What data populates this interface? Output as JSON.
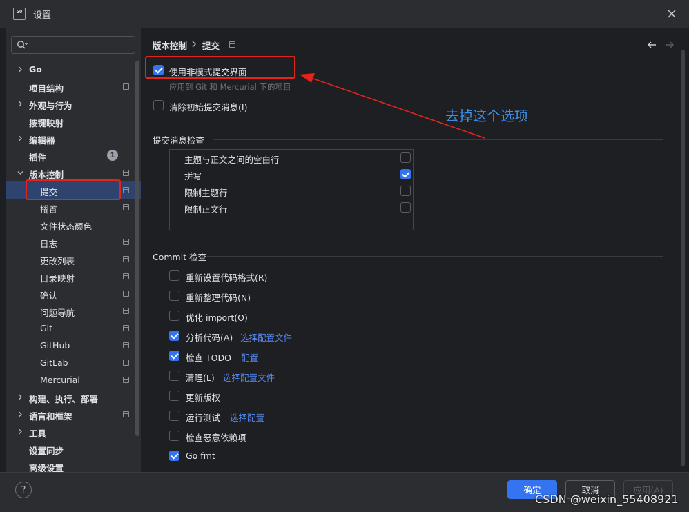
{
  "window": {
    "title": "设置",
    "logo_text": "GO"
  },
  "search": {
    "placeholder": ""
  },
  "tree": [
    {
      "id": "go",
      "label": "Go",
      "bold": true,
      "expandable": true,
      "expanded": false,
      "level": 0,
      "pinned": false
    },
    {
      "id": "project-structure",
      "label": "项目结构",
      "bold": true,
      "expandable": false,
      "level": 0,
      "pinned": true
    },
    {
      "id": "appearance",
      "label": "外观与行为",
      "bold": true,
      "expandable": true,
      "expanded": false,
      "level": 0,
      "pinned": false
    },
    {
      "id": "keymap",
      "label": "按键映射",
      "bold": true,
      "expandable": false,
      "level": 0,
      "pinned": false
    },
    {
      "id": "editor",
      "label": "编辑器",
      "bold": true,
      "expandable": true,
      "expanded": false,
      "level": 0,
      "pinned": false
    },
    {
      "id": "plugins",
      "label": "插件",
      "bold": true,
      "expandable": false,
      "level": 0,
      "badge": "1"
    },
    {
      "id": "vcs",
      "label": "版本控制",
      "bold": true,
      "expandable": true,
      "expanded": true,
      "level": 0,
      "pinned": true
    },
    {
      "id": "commit",
      "label": "提交",
      "level": 1,
      "pinned": true,
      "selected": true
    },
    {
      "id": "shelf",
      "label": "搁置",
      "level": 1,
      "pinned": true
    },
    {
      "id": "file-status-colors",
      "label": "文件状态颜色",
      "level": 1,
      "pinned": false
    },
    {
      "id": "log",
      "label": "日志",
      "level": 1,
      "pinned": true
    },
    {
      "id": "changelists",
      "label": "更改列表",
      "level": 1,
      "pinned": true
    },
    {
      "id": "directory-mappings",
      "label": "目录映射",
      "level": 1,
      "pinned": true
    },
    {
      "id": "confirmation",
      "label": "确认",
      "level": 1,
      "pinned": true
    },
    {
      "id": "issue-navigation",
      "label": "问题导航",
      "level": 1,
      "pinned": true
    },
    {
      "id": "git",
      "label": "Git",
      "level": 1,
      "pinned": true
    },
    {
      "id": "github",
      "label": "GitHub",
      "level": 1,
      "pinned": true
    },
    {
      "id": "gitlab",
      "label": "GitLab",
      "level": 1,
      "pinned": true
    },
    {
      "id": "mercurial",
      "label": "Mercurial",
      "level": 1,
      "pinned": true
    },
    {
      "id": "build",
      "label": "构建、执行、部署",
      "bold": true,
      "expandable": true,
      "expanded": false,
      "level": 0,
      "pinned": false
    },
    {
      "id": "languages",
      "label": "语言和框架",
      "bold": true,
      "expandable": true,
      "expanded": false,
      "level": 0,
      "pinned": true
    },
    {
      "id": "tools",
      "label": "工具",
      "bold": true,
      "expandable": true,
      "expanded": false,
      "level": 0,
      "pinned": false
    },
    {
      "id": "settings-sync",
      "label": "设置同步",
      "bold": true,
      "expandable": false,
      "level": 0,
      "pinned": false
    },
    {
      "id": "advanced",
      "label": "高级设置",
      "bold": true,
      "expandable": false,
      "level": 0,
      "pinned": false
    }
  ],
  "breadcrumb": {
    "parent": "版本控制",
    "current": "提交"
  },
  "commit": {
    "use_non_modal": {
      "label": "使用非模式提交界面",
      "checked": true,
      "hint": "应用到 Git 和 Mercurial 下的项目"
    },
    "clear_initial": {
      "label": "清除初始提交消息(I)",
      "checked": false
    }
  },
  "message_inspection": {
    "title": "提交消息检查",
    "items": [
      {
        "label": "主题与正文之间的空白行",
        "checked": false
      },
      {
        "label": "拼写",
        "checked": true
      },
      {
        "label": "限制主题行",
        "checked": false
      },
      {
        "label": "限制正文行",
        "checked": false
      }
    ]
  },
  "commit_checks": {
    "title": "Commit 检查",
    "items": [
      {
        "label": "重新设置代码格式(R)",
        "checked": false,
        "link": ""
      },
      {
        "label": "重新整理代码(N)",
        "checked": false,
        "link": ""
      },
      {
        "label": "优化 import(O)",
        "checked": false,
        "link": ""
      },
      {
        "label": "分析代码(A)",
        "checked": true,
        "link": "选择配置文件"
      },
      {
        "label": "检查 TODO",
        "checked": true,
        "link": "配置"
      },
      {
        "label": "清理(L)",
        "checked": false,
        "link": "选择配置文件"
      },
      {
        "label": "更新版权",
        "checked": false,
        "link": ""
      },
      {
        "label": "运行测试",
        "checked": false,
        "link": "选择配置"
      },
      {
        "label": "检查恶意依赖项",
        "checked": false,
        "link": ""
      },
      {
        "label": "Go fmt",
        "checked": true,
        "link": ""
      }
    ]
  },
  "annotation": {
    "text": "去掉这个选项",
    "color": "#3d8ee8",
    "arrow_color": "#e3241d"
  },
  "buttons": {
    "ok": "确定",
    "cancel": "取消",
    "apply": "应用(A)",
    "help": "?"
  },
  "watermark": "CSDN @weixin_55408921",
  "colors": {
    "accent": "#3574f0",
    "link": "#548af7",
    "selection": "#2e436e",
    "highlight_box": "#e3241d"
  }
}
